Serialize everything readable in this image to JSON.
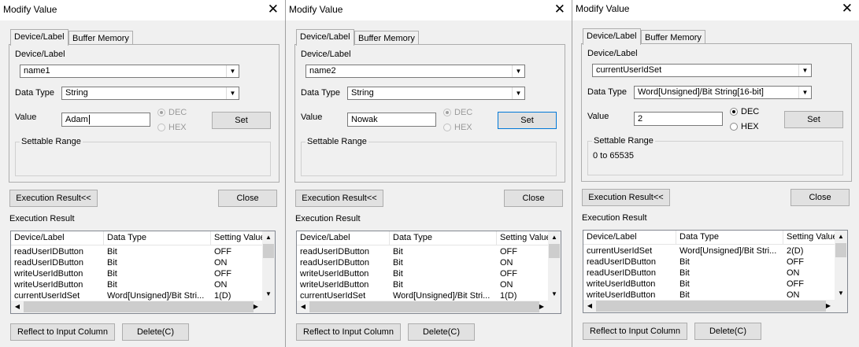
{
  "dialogs": [
    {
      "title": "Modify Value",
      "tabs": [
        "Device/Label",
        "Buffer Memory"
      ],
      "device_label_caption": "Device/Label",
      "device_label_value": "name1",
      "data_type_caption": "Data Type",
      "data_type_value": "String",
      "value_caption": "Value",
      "value_text": "Adam",
      "radio_dec": "DEC",
      "radio_hex": "HEX",
      "radix_selected": "DEC",
      "radix_enabled": false,
      "set_label": "Set",
      "settable_range_caption": "Settable Range",
      "settable_range_value": "",
      "execution_result_toggle": "Execution Result<<",
      "close_label": "Close",
      "execution_result_caption": "Execution Result",
      "columns": [
        "Device/Label",
        "Data Type",
        "Setting Value"
      ],
      "rows": [
        [
          "readUserIDButton",
          "Bit",
          "OFF"
        ],
        [
          "readUserIDButton",
          "Bit",
          "ON"
        ],
        [
          "writeUserIdButton",
          "Bit",
          "OFF"
        ],
        [
          "writeUserIdButton",
          "Bit",
          "ON"
        ],
        [
          "currentUserIdSet",
          "Word[Unsigned]/Bit Stri...",
          "1(D)"
        ]
      ],
      "reflect_label": "Reflect to Input Column",
      "delete_label": "Delete(C)"
    },
    {
      "title": "Modify Value",
      "tabs": [
        "Device/Label",
        "Buffer Memory"
      ],
      "device_label_caption": "Device/Label",
      "device_label_value": "name2",
      "data_type_caption": "Data Type",
      "data_type_value": "String",
      "value_caption": "Value",
      "value_text": "Nowak",
      "radio_dec": "DEC",
      "radio_hex": "HEX",
      "radix_selected": "DEC",
      "radix_enabled": false,
      "set_label": "Set",
      "settable_range_caption": "Settable Range",
      "settable_range_value": "",
      "execution_result_toggle": "Execution Result<<",
      "close_label": "Close",
      "execution_result_caption": "Execution Result",
      "columns": [
        "Device/Label",
        "Data Type",
        "Setting Value"
      ],
      "rows": [
        [
          "readUserIDButton",
          "Bit",
          "OFF"
        ],
        [
          "readUserIDButton",
          "Bit",
          "ON"
        ],
        [
          "writeUserIdButton",
          "Bit",
          "OFF"
        ],
        [
          "writeUserIdButton",
          "Bit",
          "ON"
        ],
        [
          "currentUserIdSet",
          "Word[Unsigned]/Bit Stri...",
          "1(D)"
        ]
      ],
      "reflect_label": "Reflect to Input Column",
      "delete_label": "Delete(C)"
    },
    {
      "title": "Modify Value",
      "tabs": [
        "Device/Label",
        "Buffer Memory"
      ],
      "device_label_caption": "Device/Label",
      "device_label_value": "currentUserIdSet",
      "data_type_caption": "Data Type",
      "data_type_value": "Word[Unsigned]/Bit String[16-bit]",
      "value_caption": "Value",
      "value_text": "2",
      "radio_dec": "DEC",
      "radio_hex": "HEX",
      "radix_selected": "DEC",
      "radix_enabled": true,
      "set_label": "Set",
      "settable_range_caption": "Settable Range",
      "settable_range_value": "0 to 65535",
      "execution_result_toggle": "Execution Result<<",
      "close_label": "Close",
      "execution_result_caption": "Execution Result",
      "columns": [
        "Device/Label",
        "Data Type",
        "Setting Value"
      ],
      "rows": [
        [
          "currentUserIdSet",
          "Word[Unsigned]/Bit Stri...",
          "2(D)"
        ],
        [
          "readUserIDButton",
          "Bit",
          "OFF"
        ],
        [
          "readUserIDButton",
          "Bit",
          "ON"
        ],
        [
          "writeUserIdButton",
          "Bit",
          "OFF"
        ],
        [
          "writeUserIdButton",
          "Bit",
          "ON"
        ]
      ],
      "reflect_label": "Reflect to Input Column",
      "delete_label": "Delete(C)"
    }
  ]
}
